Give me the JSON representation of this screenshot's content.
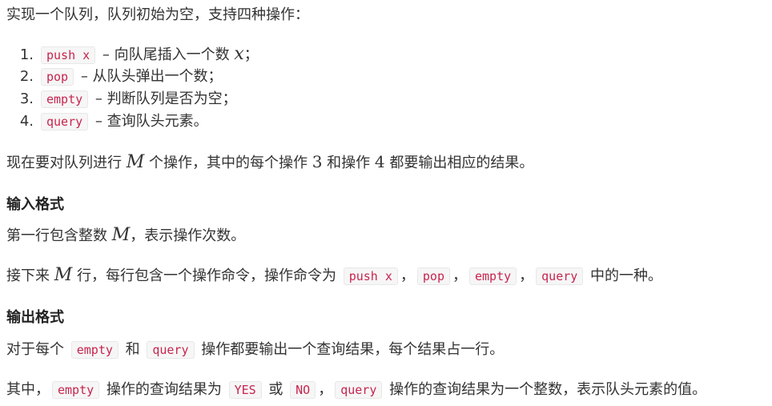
{
  "intro": "实现一个队列，队列初始为空，支持四种操作：",
  "operations": [
    {
      "num": "1.",
      "code": "push x",
      "desc_pre": " – 向队尾插入一个数 ",
      "math": "x",
      "desc_post": "；"
    },
    {
      "num": "2.",
      "code": "pop",
      "desc_pre": " – 从队头弹出一个数；",
      "math": "",
      "desc_post": ""
    },
    {
      "num": "3.",
      "code": "empty",
      "desc_pre": " – 判断队列是否为空；",
      "math": "",
      "desc_post": ""
    },
    {
      "num": "4.",
      "code": "query",
      "desc_pre": " – 查询队头元素。",
      "math": "",
      "desc_post": ""
    }
  ],
  "ops_paragraph": {
    "t1": "现在要对队列进行 ",
    "m": "M",
    "t2": " 个操作，其中的每个操作 ",
    "n3": "3",
    "t3": " 和操作 ",
    "n4": "4",
    "t4": " 都要输出相应的结果。"
  },
  "input_heading": "输入格式",
  "first_line": {
    "t1": "第一行包含整数 ",
    "m": "M",
    "t2": "，表示操作次数。"
  },
  "next_lines": {
    "t1": "接下来 ",
    "m": "M",
    "t2": " 行，每行包含一个操作命令，操作命令为 ",
    "c1": "push x",
    "s1": "，",
    "c2": "pop",
    "s2": "，",
    "c3": "empty",
    "s3": "，",
    "c4": "query",
    "t3": " 中的一种。"
  },
  "output_heading": "输出格式",
  "each_output": {
    "t1": "对于每个 ",
    "c1": "empty",
    "t2": " 和 ",
    "c2": "query",
    "t3": " 操作都要输出一个查询结果，每个结果占一行。"
  },
  "among": {
    "t1": "其中，",
    "c1": "empty",
    "t2": " 操作的查询结果为 ",
    "c2": "YES",
    "t3": " 或 ",
    "c3": "NO",
    "t4": "，",
    "c4": "query",
    "t5": " 操作的查询结果为一个整数，表示队头元素的值。"
  }
}
